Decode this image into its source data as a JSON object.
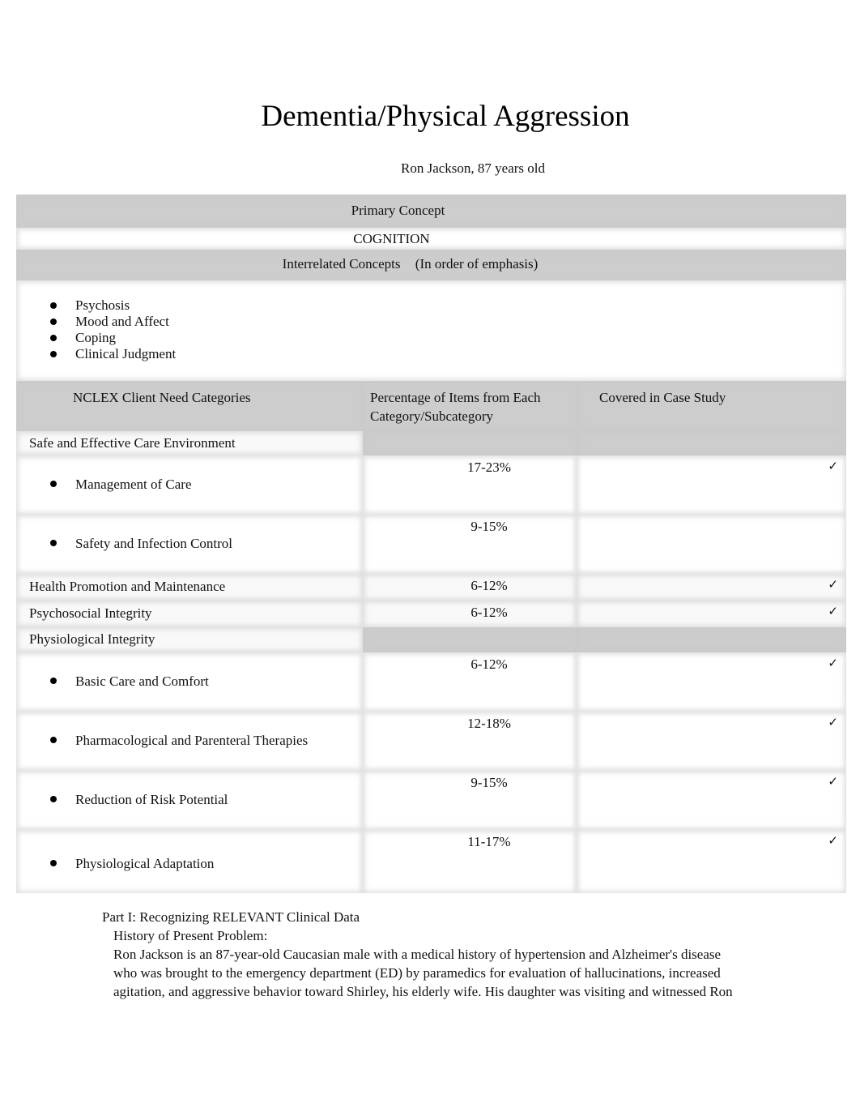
{
  "document": {
    "title": "Dementia/Physical Aggression",
    "subtitle": "Ron Jackson, 87 years old"
  },
  "concepts": {
    "primary_label": "Primary Concept",
    "primary_value": "COGNITION",
    "interrelated_label": "Interrelated Concepts",
    "interrelated_note": "(In order of emphasis)",
    "interrelated_items": [
      "Psychosis",
      "Mood and Affect",
      "Coping",
      "Clinical Judgment"
    ]
  },
  "nclex_table": {
    "headers": {
      "category": "NCLEX Client Need Categories",
      "percentage_line1": "Percentage of Items from Each",
      "percentage_line2": "Category/Subcategory",
      "covered": "Covered in Case Study"
    },
    "check_glyph": "✓",
    "rows": [
      {
        "label": "Safe and Effective Care Environment",
        "type": "category",
        "percentage": "",
        "covered": false
      },
      {
        "label": "Management of Care",
        "type": "subcategory",
        "percentage": "17-23%",
        "covered": true
      },
      {
        "label": "Safety and Infection Control",
        "type": "subcategory",
        "percentage": "9-15%",
        "covered": false
      },
      {
        "label": "Health Promotion and Maintenance",
        "type": "category",
        "percentage": "6-12%",
        "covered": true
      },
      {
        "label": "Psychosocial Integrity",
        "type": "category",
        "percentage": "6-12%",
        "covered": true
      },
      {
        "label": "Physiological Integrity",
        "type": "category",
        "percentage": "",
        "covered": false
      },
      {
        "label": "Basic Care and Comfort",
        "type": "subcategory",
        "percentage": "6-12%",
        "covered": true
      },
      {
        "label": "Pharmacological and Parenteral Therapies",
        "type": "subcategory",
        "percentage": "12-18%",
        "covered": true
      },
      {
        "label": "Reduction of Risk Potential",
        "type": "subcategory",
        "percentage": "9-15%",
        "covered": true
      },
      {
        "label": "Physiological Adaptation",
        "type": "subcategory",
        "percentage": "11-17%",
        "covered": true
      }
    ]
  },
  "part1": {
    "heading": "Part I: Recognizing RELEVANT Clinical Data",
    "subheading": "History of Present Problem:",
    "lines": [
      "Ron Jackson is an 87-year-old Caucasian male with a medical history of hypertension and Alzheimer's disease",
      "who was brought to the emergency department (ED) by paramedics for evaluation of hallucinations, increased",
      "agitation, and aggressive behavior toward Shirley, his elderly wife. His daughter was visiting and witnessed Ron"
    ]
  }
}
